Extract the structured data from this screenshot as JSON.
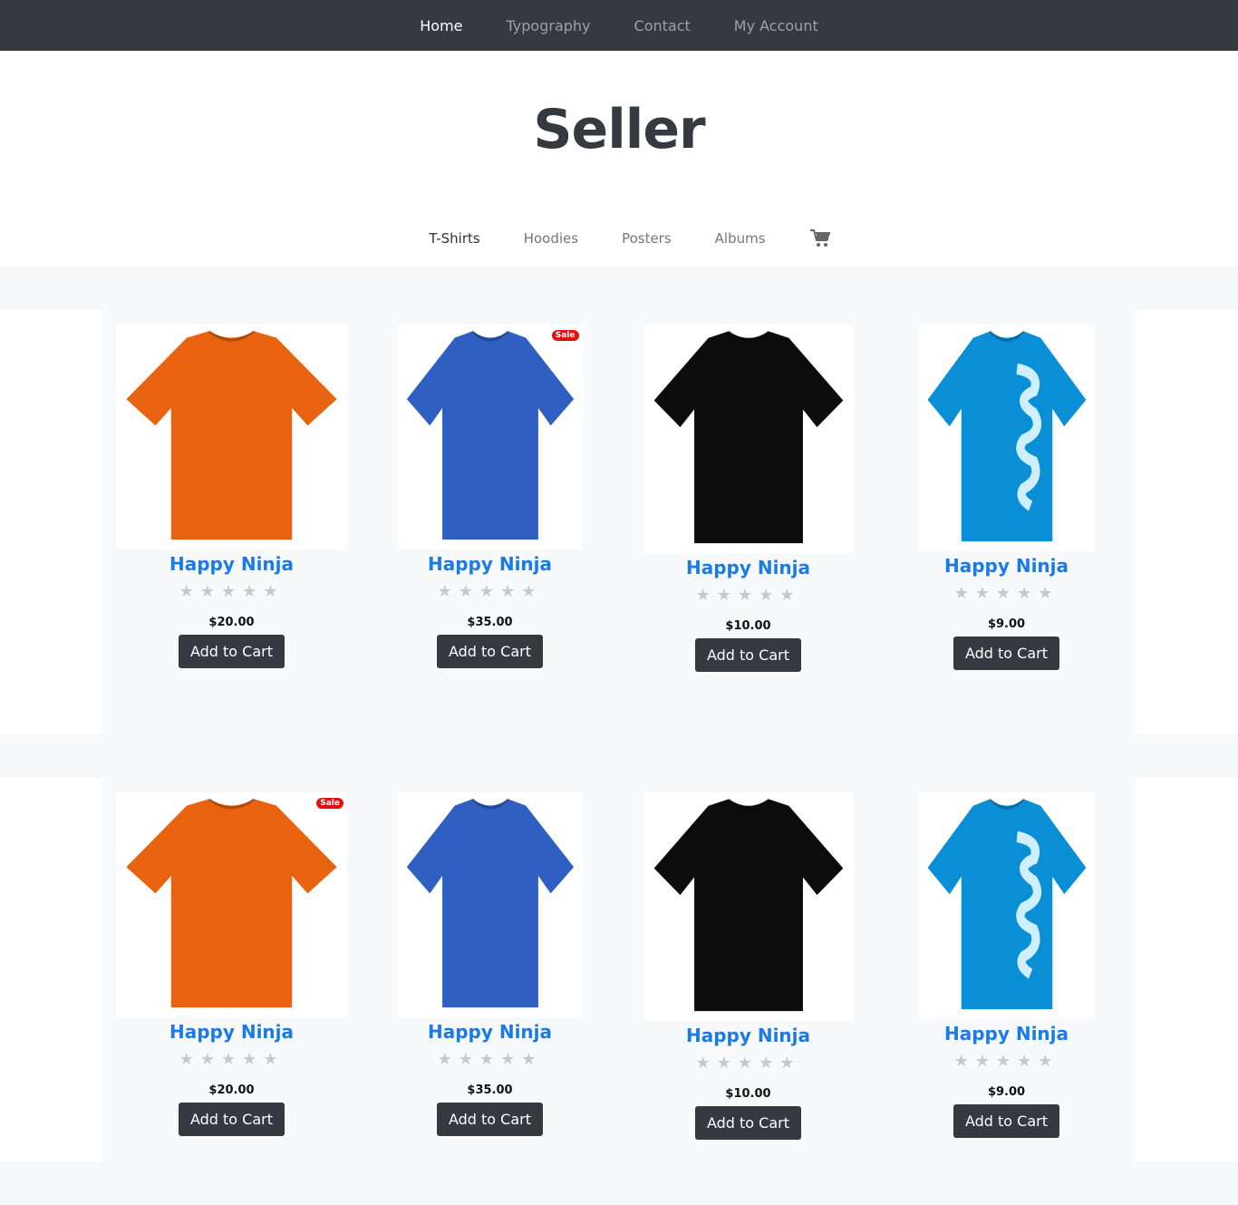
{
  "topnav": {
    "items": [
      "Home",
      "Typography",
      "Contact",
      "My Account"
    ]
  },
  "site": {
    "title": "Seller"
  },
  "catnav": {
    "items": [
      "T-Shirts",
      "Hoodies",
      "Posters",
      "Albums"
    ],
    "cart_icon": "shopping-cart-icon"
  },
  "products": [
    [
      {
        "name": "Happy Ninja",
        "price": "$20.00",
        "button": "Add to Cart",
        "color": "#e8620f",
        "sale": "",
        "rating": 0,
        "stars": "★★★★★"
      },
      {
        "name": "Happy Ninja",
        "price": "$35.00",
        "button": "Add to Cart",
        "color": "#2f5fc0",
        "sale": "Sale",
        "rating": 0,
        "stars": "★★★★★"
      },
      {
        "name": "Happy Ninja",
        "price": "$10.00",
        "button": "Add to Cart",
        "color": "#0c0c0c",
        "sale": "",
        "rating": 0,
        "stars": "★★★★★"
      },
      {
        "name": "Happy Ninja",
        "price": "$9.00",
        "button": "Add to Cart",
        "color": "#0a8fd6",
        "sale": "",
        "rating": 0,
        "stars": "★★★★★"
      }
    ],
    [
      {
        "name": "Happy Ninja",
        "price": "$20.00",
        "button": "Add to Cart",
        "color": "#e8620f",
        "sale": "Sale",
        "rating": 0,
        "stars": "★★★★★"
      },
      {
        "name": "Happy Ninja",
        "price": "$35.00",
        "button": "Add to Cart",
        "color": "#2f5fc0",
        "sale": "",
        "rating": 0,
        "stars": "★★★★★"
      },
      {
        "name": "Happy Ninja",
        "price": "$10.00",
        "button": "Add to Cart",
        "color": "#0c0c0c",
        "sale": "",
        "rating": 0,
        "stars": "★★★★★"
      },
      {
        "name": "Happy Ninja",
        "price": "$9.00",
        "button": "Add to Cart",
        "color": "#0a8fd6",
        "sale": "",
        "rating": 0,
        "stars": "★★★★★"
      }
    ]
  ]
}
